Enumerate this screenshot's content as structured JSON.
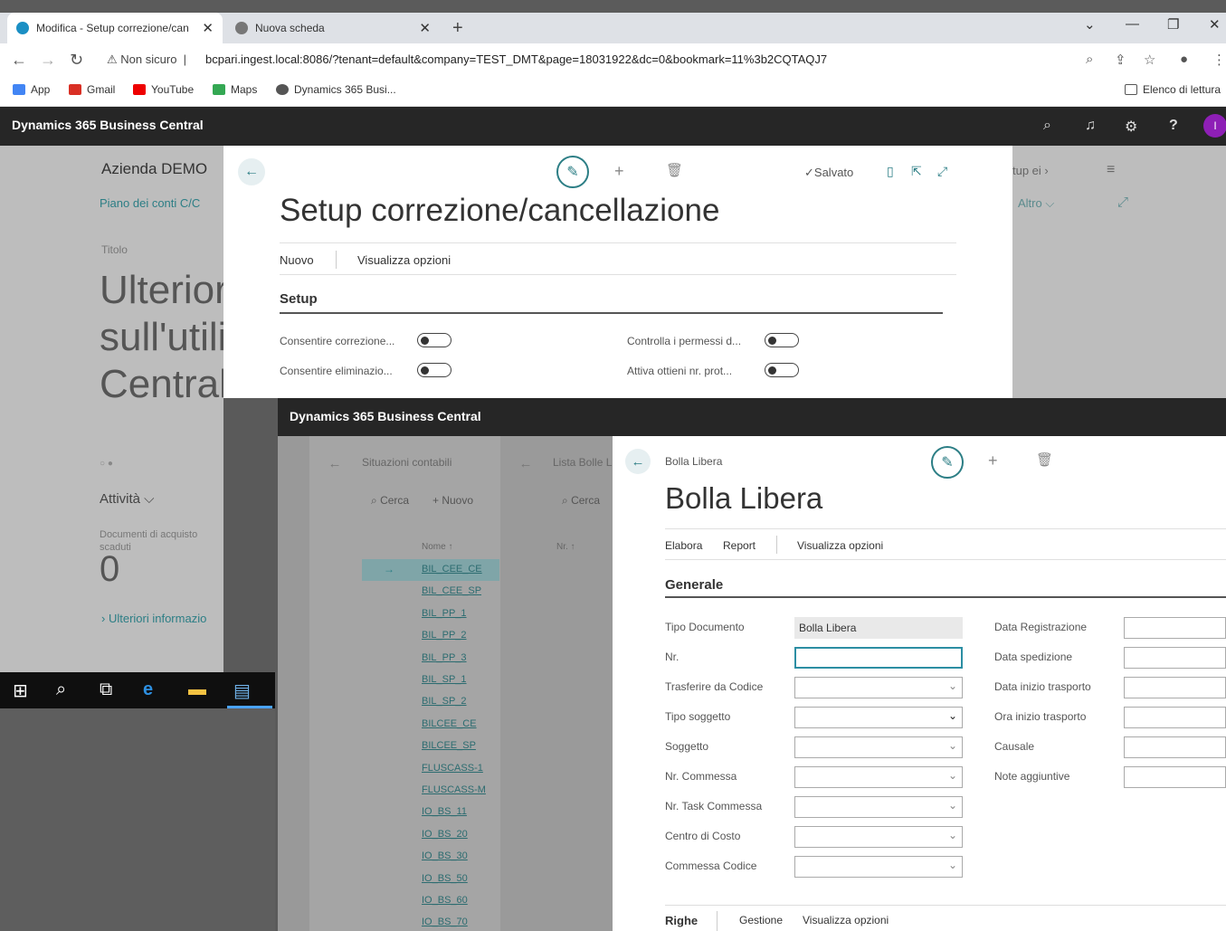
{
  "browser": {
    "tabs": [
      {
        "title": "Modifica - Setup correzione/can"
      },
      {
        "title": "Nuova scheda"
      }
    ],
    "security_label": "Non sicuro",
    "url": "bcpari.ingest.local:8086/?tenant=default&company=TEST_DMT&page=18031922&dc=0&bookmark=11%3b2CQTAQJ7",
    "bookmarks": [
      "App",
      "Gmail",
      "YouTube",
      "Maps",
      "Dynamics 365 Busi..."
    ],
    "reading_list": "Elenco di lettura"
  },
  "bc_header": {
    "brand": "Dynamics 365 Business Central",
    "avatar": "I"
  },
  "role_center": {
    "company": "Azienda DEMO",
    "nav": "Piano dei conti   C/C",
    "title_label": "Titolo",
    "big_title": "Ulterior\nsull'utili\nCentral",
    "activity": "Attività ⌵",
    "docs_label": "Documenti di acquisto scaduti",
    "docs_count": "0",
    "more_link": "Ulteriori informazio"
  },
  "right_dim": {
    "setup_link": "tup ei",
    "altro": "Altro ⌵"
  },
  "setup": {
    "saved": "Salvato",
    "title": "Setup correzione/cancellazione",
    "actions": [
      "Nuovo",
      "Visualizza opzioni"
    ],
    "section": "Setup",
    "fields": [
      {
        "label": "Consentire correzione..."
      },
      {
        "label": "Consentire eliminazio..."
      },
      {
        "label": "Controlla i permessi d..."
      },
      {
        "label": "Attiva ottieni nr. prot..."
      }
    ]
  },
  "inner": {
    "brand": "Dynamics 365 Business Central",
    "listA": {
      "header": "Situazioni contabili",
      "search": "Cerca",
      "new": "Nuovo",
      "column": "Nome ↑",
      "rows": [
        "BIL_CEE_CE",
        "BIL_CEE_SP",
        "BIL_PP_1",
        "BIL_PP_2",
        "BIL_PP_3",
        "BIL_SP_1",
        "BIL_SP_2",
        "BILCEE_CE",
        "BILCEE_SP",
        "FLUSCASS-1",
        "FLUSCASS-M",
        "IO_BS_11",
        "IO_BS_20",
        "IO_BS_30",
        "IO_BS_50",
        "IO_BS_60",
        "IO_BS_70"
      ]
    },
    "listB": {
      "header": "Lista Bolle L",
      "search": "Cerca",
      "column": "Nr. ↑"
    },
    "bolla": {
      "breadcrumb": "Bolla Libera",
      "title": "Bolla Libera",
      "actions": [
        "Elabora",
        "Report",
        "Visualizza opzioni"
      ],
      "section": "Generale",
      "left_fields": [
        {
          "label": "Tipo Documento",
          "value": "Bolla Libera"
        },
        {
          "label": "Nr.",
          "value": ""
        },
        {
          "label": "Trasferire da Codice",
          "value": ""
        },
        {
          "label": "Tipo soggetto",
          "value": ""
        },
        {
          "label": "Soggetto",
          "value": ""
        },
        {
          "label": "Nr. Commessa",
          "value": ""
        },
        {
          "label": "Nr. Task Commessa",
          "value": ""
        },
        {
          "label": "Centro di Costo",
          "value": ""
        },
        {
          "label": "Commessa Codice",
          "value": ""
        }
      ],
      "right_fields": [
        {
          "label": "Data Registrazione",
          "value": ""
        },
        {
          "label": "Data spedizione",
          "value": ""
        },
        {
          "label": "Data inizio trasporto",
          "value": ""
        },
        {
          "label": "Ora inizio trasporto",
          "value": ""
        },
        {
          "label": "Causale",
          "value": ""
        },
        {
          "label": "Note aggiuntive",
          "value": ""
        }
      ],
      "footer": [
        "Righe",
        "Gestione",
        "Visualizza opzioni"
      ]
    }
  },
  "colors": {
    "accent": "#2c7e85",
    "bc_header": "#262626",
    "avatar": "#8e1fb6"
  }
}
